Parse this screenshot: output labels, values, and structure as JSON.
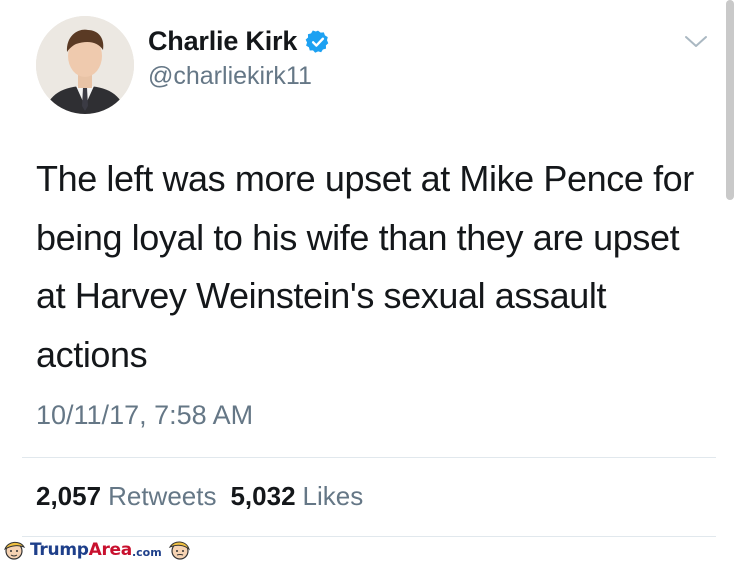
{
  "author": {
    "display_name": "Charlie Kirk",
    "handle": "@charliekirk11",
    "verified": true,
    "avatar_icon": "profile-photo",
    "verified_icon": "verified-badge-icon",
    "verified_color": "#1da1f2"
  },
  "tweet": {
    "text": "The left was more upset at Mike Pence for being loyal to his wife than they are upset at Harvey Weinstein's sexual assault actions",
    "timestamp": "10/11/17, 7:58 AM"
  },
  "stats": {
    "retweets_count": "2,057",
    "retweets_label": "Retweets",
    "likes_count": "5,032",
    "likes_label": "Likes"
  },
  "menu": {
    "icon": "chevron-down-icon"
  },
  "watermark": {
    "brand_part1": "Trump",
    "brand_part2": "Area",
    "brand_suffix": ".com",
    "primary_color": "#1e3f8a",
    "accent_color": "#c8102e"
  }
}
